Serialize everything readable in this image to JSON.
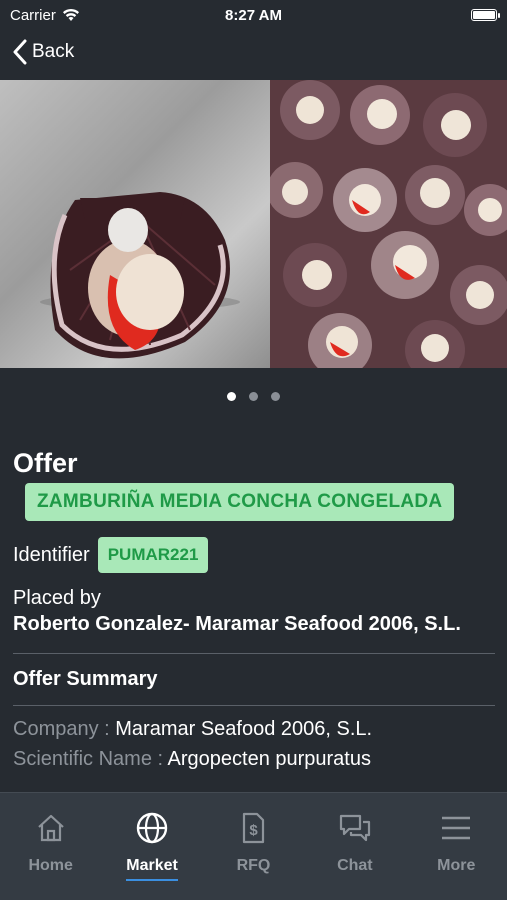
{
  "status": {
    "carrier": "Carrier",
    "time": "8:27 AM"
  },
  "nav": {
    "back_label": "Back"
  },
  "gallery": {
    "page_count": 3,
    "active_page": 1
  },
  "offer": {
    "heading": "Offer",
    "product": "ZAMBURIÑA MEDIA CONCHA CONGELADA",
    "identifier_label": "Identifier",
    "identifier": "PUMAR221",
    "placed_by_label": "Placed by",
    "placed_by": "Roberto Gonzalez- Maramar Seafood 2006, S.L."
  },
  "summary": {
    "title": "Offer Summary",
    "rows": [
      {
        "key": "Company : ",
        "value": "Maramar Seafood 2006, S.L."
      },
      {
        "key": "Scientific Name : ",
        "value": "Argopecten purpuratus"
      }
    ]
  },
  "tabs": [
    {
      "label": "Home",
      "icon": "home-icon",
      "active": false
    },
    {
      "label": "Market",
      "icon": "globe-icon",
      "active": true
    },
    {
      "label": "RFQ",
      "icon": "dollar-document-icon",
      "active": false
    },
    {
      "label": "Chat",
      "icon": "chat-icon",
      "active": false
    },
    {
      "label": "More",
      "icon": "menu-icon",
      "active": false
    }
  ],
  "colors": {
    "background": "#262b31",
    "tabbar": "#343b43",
    "tag_bg": "#a9e8b8",
    "tag_text": "#1f9a47",
    "accent": "#3b8fe0"
  }
}
